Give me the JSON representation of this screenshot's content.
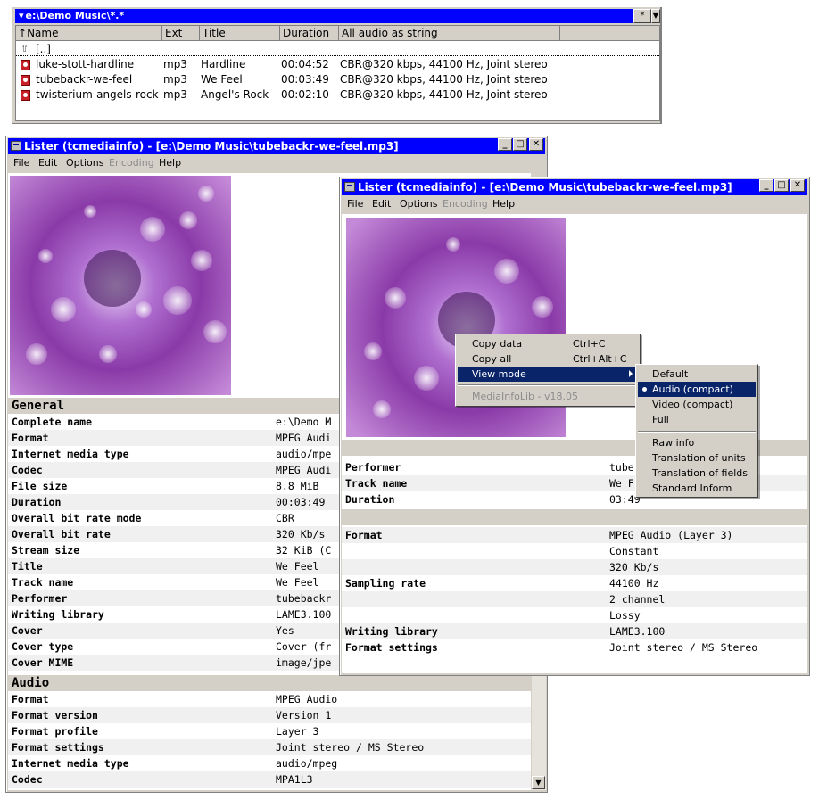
{
  "file_panel": {
    "path": "e:\\Demo Music\\*.*",
    "star_button": "*",
    "dropdown_button": "▼",
    "columns": [
      "Name",
      "Ext",
      "Title",
      "Duration",
      "All audio as string"
    ],
    "up_row": "[..]",
    "rows": [
      {
        "name": "luke-stott-hardline",
        "ext": "mp3",
        "title": "Hardline",
        "duration": "00:04:52",
        "audio": "CBR@320 kbps, 44100 Hz, Joint stereo"
      },
      {
        "name": "tubebackr-we-feel",
        "ext": "mp3",
        "title": "We Feel",
        "duration": "00:03:49",
        "audio": "CBR@320 kbps, 44100 Hz, Joint stereo"
      },
      {
        "name": "twisterium-angels-rock",
        "ext": "mp3",
        "title": "Angel's Rock",
        "duration": "00:02:10",
        "audio": "CBR@320 kbps, 44100 Hz, Joint stereo"
      }
    ]
  },
  "lister_back": {
    "title": "Lister (tcmediainfo) - [e:\\Demo Music\\tubebackr-we-feel.mp3]",
    "menu": [
      "File",
      "Edit",
      "Options",
      "Encoding",
      "Help"
    ],
    "sections": [
      {
        "name": "General",
        "rows": [
          {
            "key": "Complete name",
            "value": "e:\\Demo M"
          },
          {
            "key": "Format",
            "value": "MPEG Audi"
          },
          {
            "key": "Internet media type",
            "value": "audio/mpe"
          },
          {
            "key": "Codec",
            "value": "MPEG Audi"
          },
          {
            "key": "File size",
            "value": "8.8 MiB"
          },
          {
            "key": "Duration",
            "value": "00:03:49"
          },
          {
            "key": "Overall bit rate mode",
            "value": "CBR"
          },
          {
            "key": "Overall bit rate",
            "value": "320 Kb/s"
          },
          {
            "key": "Stream size",
            "value": "32 KiB (C"
          },
          {
            "key": "Title",
            "value": "We Feel"
          },
          {
            "key": "Track name",
            "value": "We Feel"
          },
          {
            "key": "Performer",
            "value": "tubebackr"
          },
          {
            "key": "Writing library",
            "value": "LAME3.100"
          },
          {
            "key": "Cover",
            "value": "Yes"
          },
          {
            "key": "Cover type",
            "value": "Cover (fr"
          },
          {
            "key": "Cover MIME",
            "value": "image/jpe"
          }
        ]
      },
      {
        "name": "Audio",
        "rows": [
          {
            "key": "Format",
            "value": "MPEG Audio"
          },
          {
            "key": "Format version",
            "value": "Version 1"
          },
          {
            "key": "Format profile",
            "value": "Layer 3"
          },
          {
            "key": "Format settings",
            "value": "Joint stereo / MS Stereo"
          },
          {
            "key": "Internet media type",
            "value": "audio/mpeg"
          },
          {
            "key": "Codec",
            "value": "MPA1L3"
          }
        ]
      }
    ]
  },
  "lister_front": {
    "title": "Lister (tcmediainfo) - [e:\\Demo Music\\tubebackr-we-feel.mp3]",
    "menu": [
      "File",
      "Edit",
      "Options",
      "Encoding",
      "Help"
    ],
    "rows1": [
      {
        "key": "Performer",
        "value": "tube"
      },
      {
        "key": "Track name",
        "value": "We F"
      },
      {
        "key": "Duration",
        "value": "03:49"
      }
    ],
    "rows2": [
      {
        "key": "Format",
        "value": "MPEG Audio (Layer 3)"
      },
      {
        "key": "",
        "value": "Constant"
      },
      {
        "key": "",
        "value": "320 Kb/s"
      },
      {
        "key": "Sampling rate",
        "value": "44100 Hz"
      },
      {
        "key": "",
        "value": "2 channel"
      },
      {
        "key": "",
        "value": "Lossy"
      },
      {
        "key": "Writing library",
        "value": "LAME3.100"
      },
      {
        "key": "Format settings",
        "value": "Joint stereo / MS Stereo"
      }
    ]
  },
  "context_menu": {
    "copy_data": "Copy data",
    "copy_data_shortcut": "Ctrl+C",
    "copy_all": "Copy all",
    "copy_all_shortcut": "Ctrl+Alt+C",
    "view_mode": "View mode",
    "version": "MediaInfoLib - v18.05"
  },
  "submenu": {
    "default": "Default",
    "audio_compact": "Audio (compact)",
    "video_compact": "Video (compact)",
    "full": "Full",
    "raw_info": "Raw info",
    "translation_units": "Translation of units",
    "translation_fields": "Translation of fields",
    "standard_inform": "Standard Inform"
  },
  "colors": {
    "title_blue": "#0000ff",
    "selection": "#0a246a",
    "chrome": "#d4d0c8"
  },
  "icons": [
    "arrow-down-icon",
    "sort-up-icon",
    "up-folder-icon",
    "mp3-file-icon",
    "minimize-icon",
    "maximize-icon",
    "close-icon",
    "scroll-down-icon",
    "submenu-arrow-icon",
    "radio-bullet-icon"
  ]
}
